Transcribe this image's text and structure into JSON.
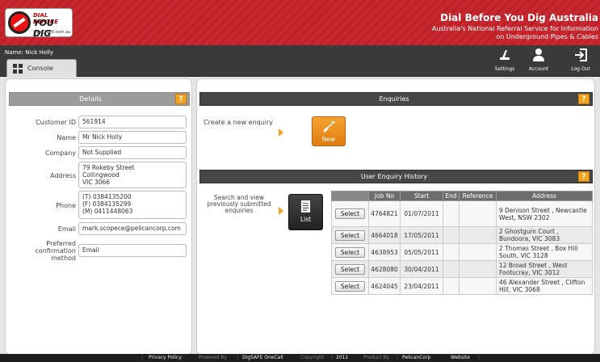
{
  "header": {
    "logo_line1": "DIAL BEFORE",
    "logo_line2": "YOU DIG",
    "logo_line3": "www.1100.com.au",
    "title": "Dial Before You Dig Australia",
    "subtitle_line1": "Australia's National Referral Service for Information",
    "subtitle_line2": "on Underground Pipes & Cables"
  },
  "toolbar": {
    "user_label": "Name: Nick Holly",
    "console_tab": "Console",
    "settings_label": "Settings",
    "account_label": "Account",
    "logout_label": "Log Out"
  },
  "details": {
    "title": "Details",
    "help": "?",
    "fields": {
      "customer_id": {
        "label": "Customer ID",
        "value": "561914"
      },
      "name": {
        "label": "Name",
        "value": "Mr Nick Holly"
      },
      "company": {
        "label": "Company",
        "value": "Not Supplied"
      },
      "address": {
        "label": "Address",
        "value": "79 Rokeby Street\nCollingwood\nVIC 3066"
      },
      "phone": {
        "label": "Phone",
        "value": "(T) 0384135200\n(F) 0384135299\n(M) 0411448063"
      },
      "email": {
        "label": "Email",
        "value": "mark.scopece@pelicancorp.com"
      },
      "pref": {
        "label": "Preferred confirmation method",
        "value": "Email"
      }
    }
  },
  "enquiries": {
    "title": "Enquiries",
    "help": "?",
    "create_text": "Create a new enquiry",
    "new_button": "New"
  },
  "history": {
    "title": "User Enquiry History",
    "help": "?",
    "search_text": "Search and view previously submitted enquiries",
    "list_button": "List",
    "columns": [
      "Job No",
      "Start",
      "End",
      "Reference",
      "Address"
    ],
    "select_label": "Select",
    "rows": [
      {
        "job": "4764821",
        "start": "01/07/2011",
        "end": "",
        "ref": "",
        "address": "9 Denison Street , Newcastle West, NSW 2302"
      },
      {
        "job": "4664018",
        "start": "17/05/2011",
        "end": "",
        "ref": "",
        "address": "2 Ghostgum Court , Bundoora, VIC 3083"
      },
      {
        "job": "4638953",
        "start": "05/05/2011",
        "end": "",
        "ref": "",
        "address": "2 Thomas Street , Box Hill South, VIC 3128"
      },
      {
        "job": "4628080",
        "start": "30/04/2011",
        "end": "",
        "ref": "",
        "address": "12 Broad Street , West Footscray, VIC 3012"
      },
      {
        "job": "4624045",
        "start": "23/04/2011",
        "end": "",
        "ref": "",
        "address": "46 Alexander Street , Clifton Hill, VIC 3068"
      }
    ]
  },
  "footer": {
    "privacy": "Privacy Policy",
    "powered_by": "Powered By",
    "digsafe": "DigSAFE OneCall",
    "copyright": "Copyright",
    "year": "2011",
    "product_by": "Product By",
    "pelican": "PelicanCorp",
    "website": "Website"
  }
}
